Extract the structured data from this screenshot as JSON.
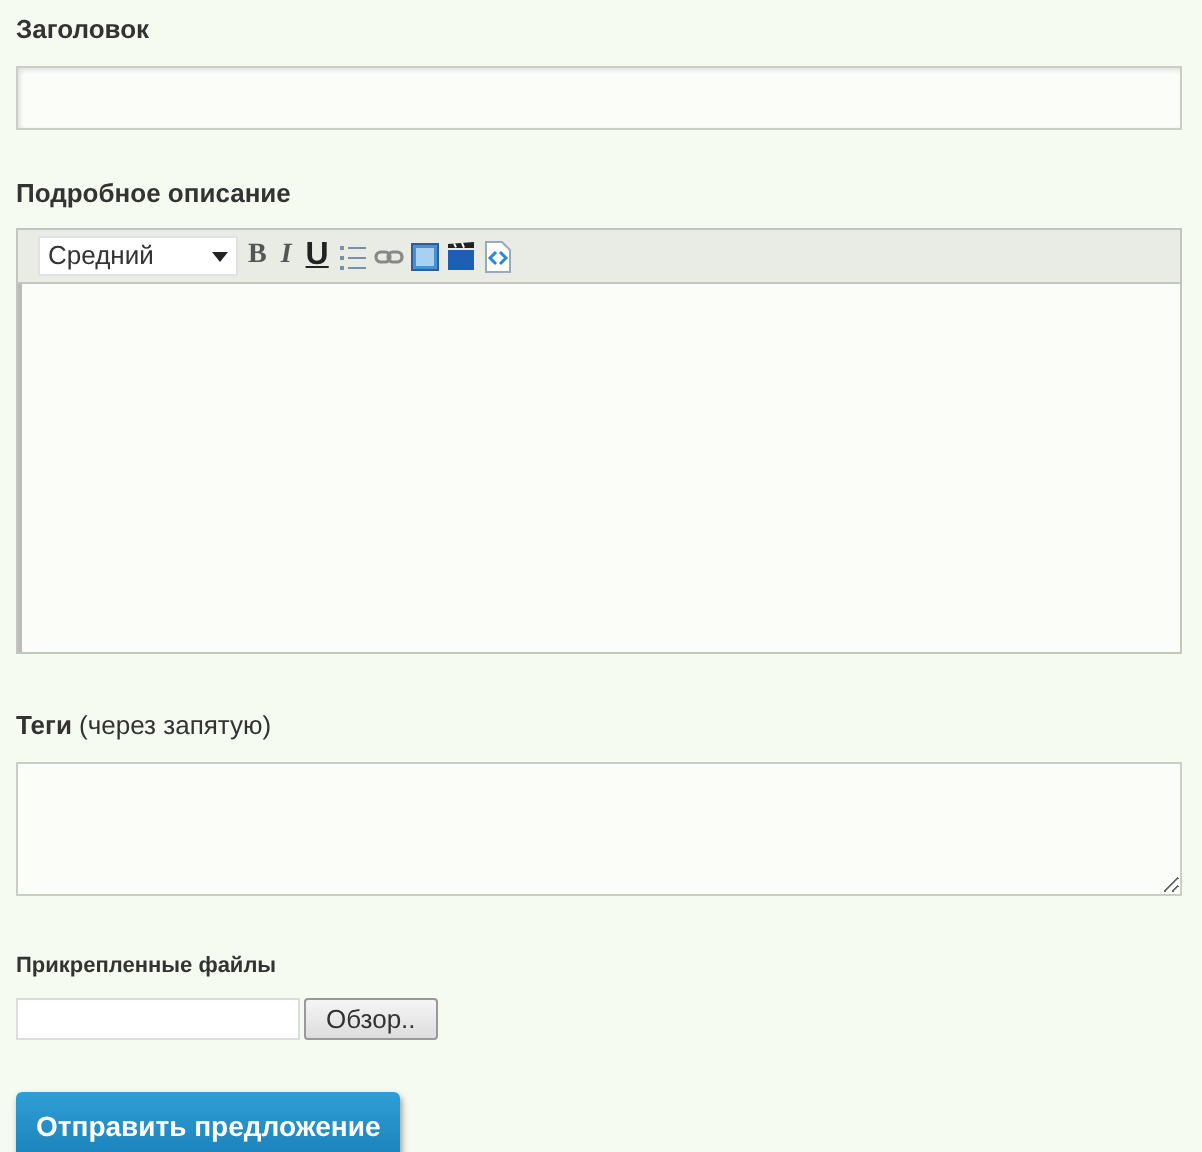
{
  "title_field": {
    "label": "Заголовок"
  },
  "description": {
    "label": "Подробное описание",
    "font_size": "Средний",
    "toolbar": [
      {
        "kind": "bold",
        "label": "B"
      },
      {
        "kind": "italic",
        "label": "I"
      },
      {
        "kind": "underline",
        "label": "U"
      },
      {
        "kind": "list"
      },
      {
        "kind": "link"
      },
      {
        "kind": "image"
      },
      {
        "kind": "video"
      },
      {
        "kind": "code"
      }
    ]
  },
  "tags": {
    "label": "Теги",
    "hint": "(через запятую)"
  },
  "attachments": {
    "label": "Прикрепленные файлы",
    "browse": "Обзор.."
  },
  "submit": "Отправить предложение"
}
